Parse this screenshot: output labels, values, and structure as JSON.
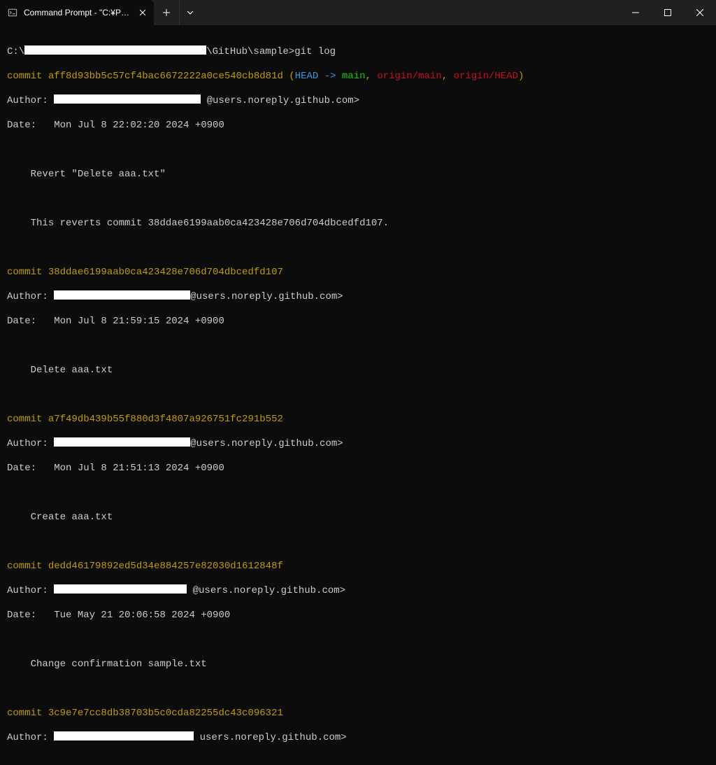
{
  "tab": {
    "title": "Command Prompt - \"C:¥Progr"
  },
  "prompt": {
    "drive": "C:\\",
    "path_suffix": "\\GitHub\\sample>",
    "command": "git log"
  },
  "commits": [
    {
      "hash": "aff8d93bb5c57cf4bac6672222a0ce540cb8d81d",
      "refs_head": "HEAD -> ",
      "refs_main": "main",
      "refs_sep1": ", ",
      "refs_remote1": "origin/main",
      "refs_sep2": ", ",
      "refs_remote2": "origin/HEAD",
      "author_suffix": "@users.noreply.github.com>",
      "date": "Mon Jul 8 22:02:20 2024 +0900",
      "message1": "Revert \"Delete aaa.txt\"",
      "message2": "This reverts commit 38ddae6199aab0ca423428e706d704dbcedfd107."
    },
    {
      "hash": "38ddae6199aab0ca423428e706d704dbcedfd107",
      "author_suffix": "@users.noreply.github.com>",
      "date": "Mon Jul 8 21:59:15 2024 +0900",
      "message1": "Delete aaa.txt"
    },
    {
      "hash": "a7f49db439b55f880d3f4807a926751fc291b552",
      "author_suffix": "@users.noreply.github.com>",
      "date": "Mon Jul 8 21:51:13 2024 +0900",
      "message1": "Create aaa.txt"
    },
    {
      "hash": "dedd46179892ed5d34e884257e82030d1612848f",
      "author_suffix": "@users.noreply.github.com>",
      "date": "Tue May 21 20:06:58 2024 +0900",
      "message1": "Change confirmation sample.txt"
    },
    {
      "hash": "3c9e7e7cc8db38703b5c0cda82255dc43c096321",
      "author_suffix": "users.noreply.github.com>"
    }
  ],
  "labels": {
    "commit": "commit ",
    "author": "Author: ",
    "date": "Date:   "
  }
}
